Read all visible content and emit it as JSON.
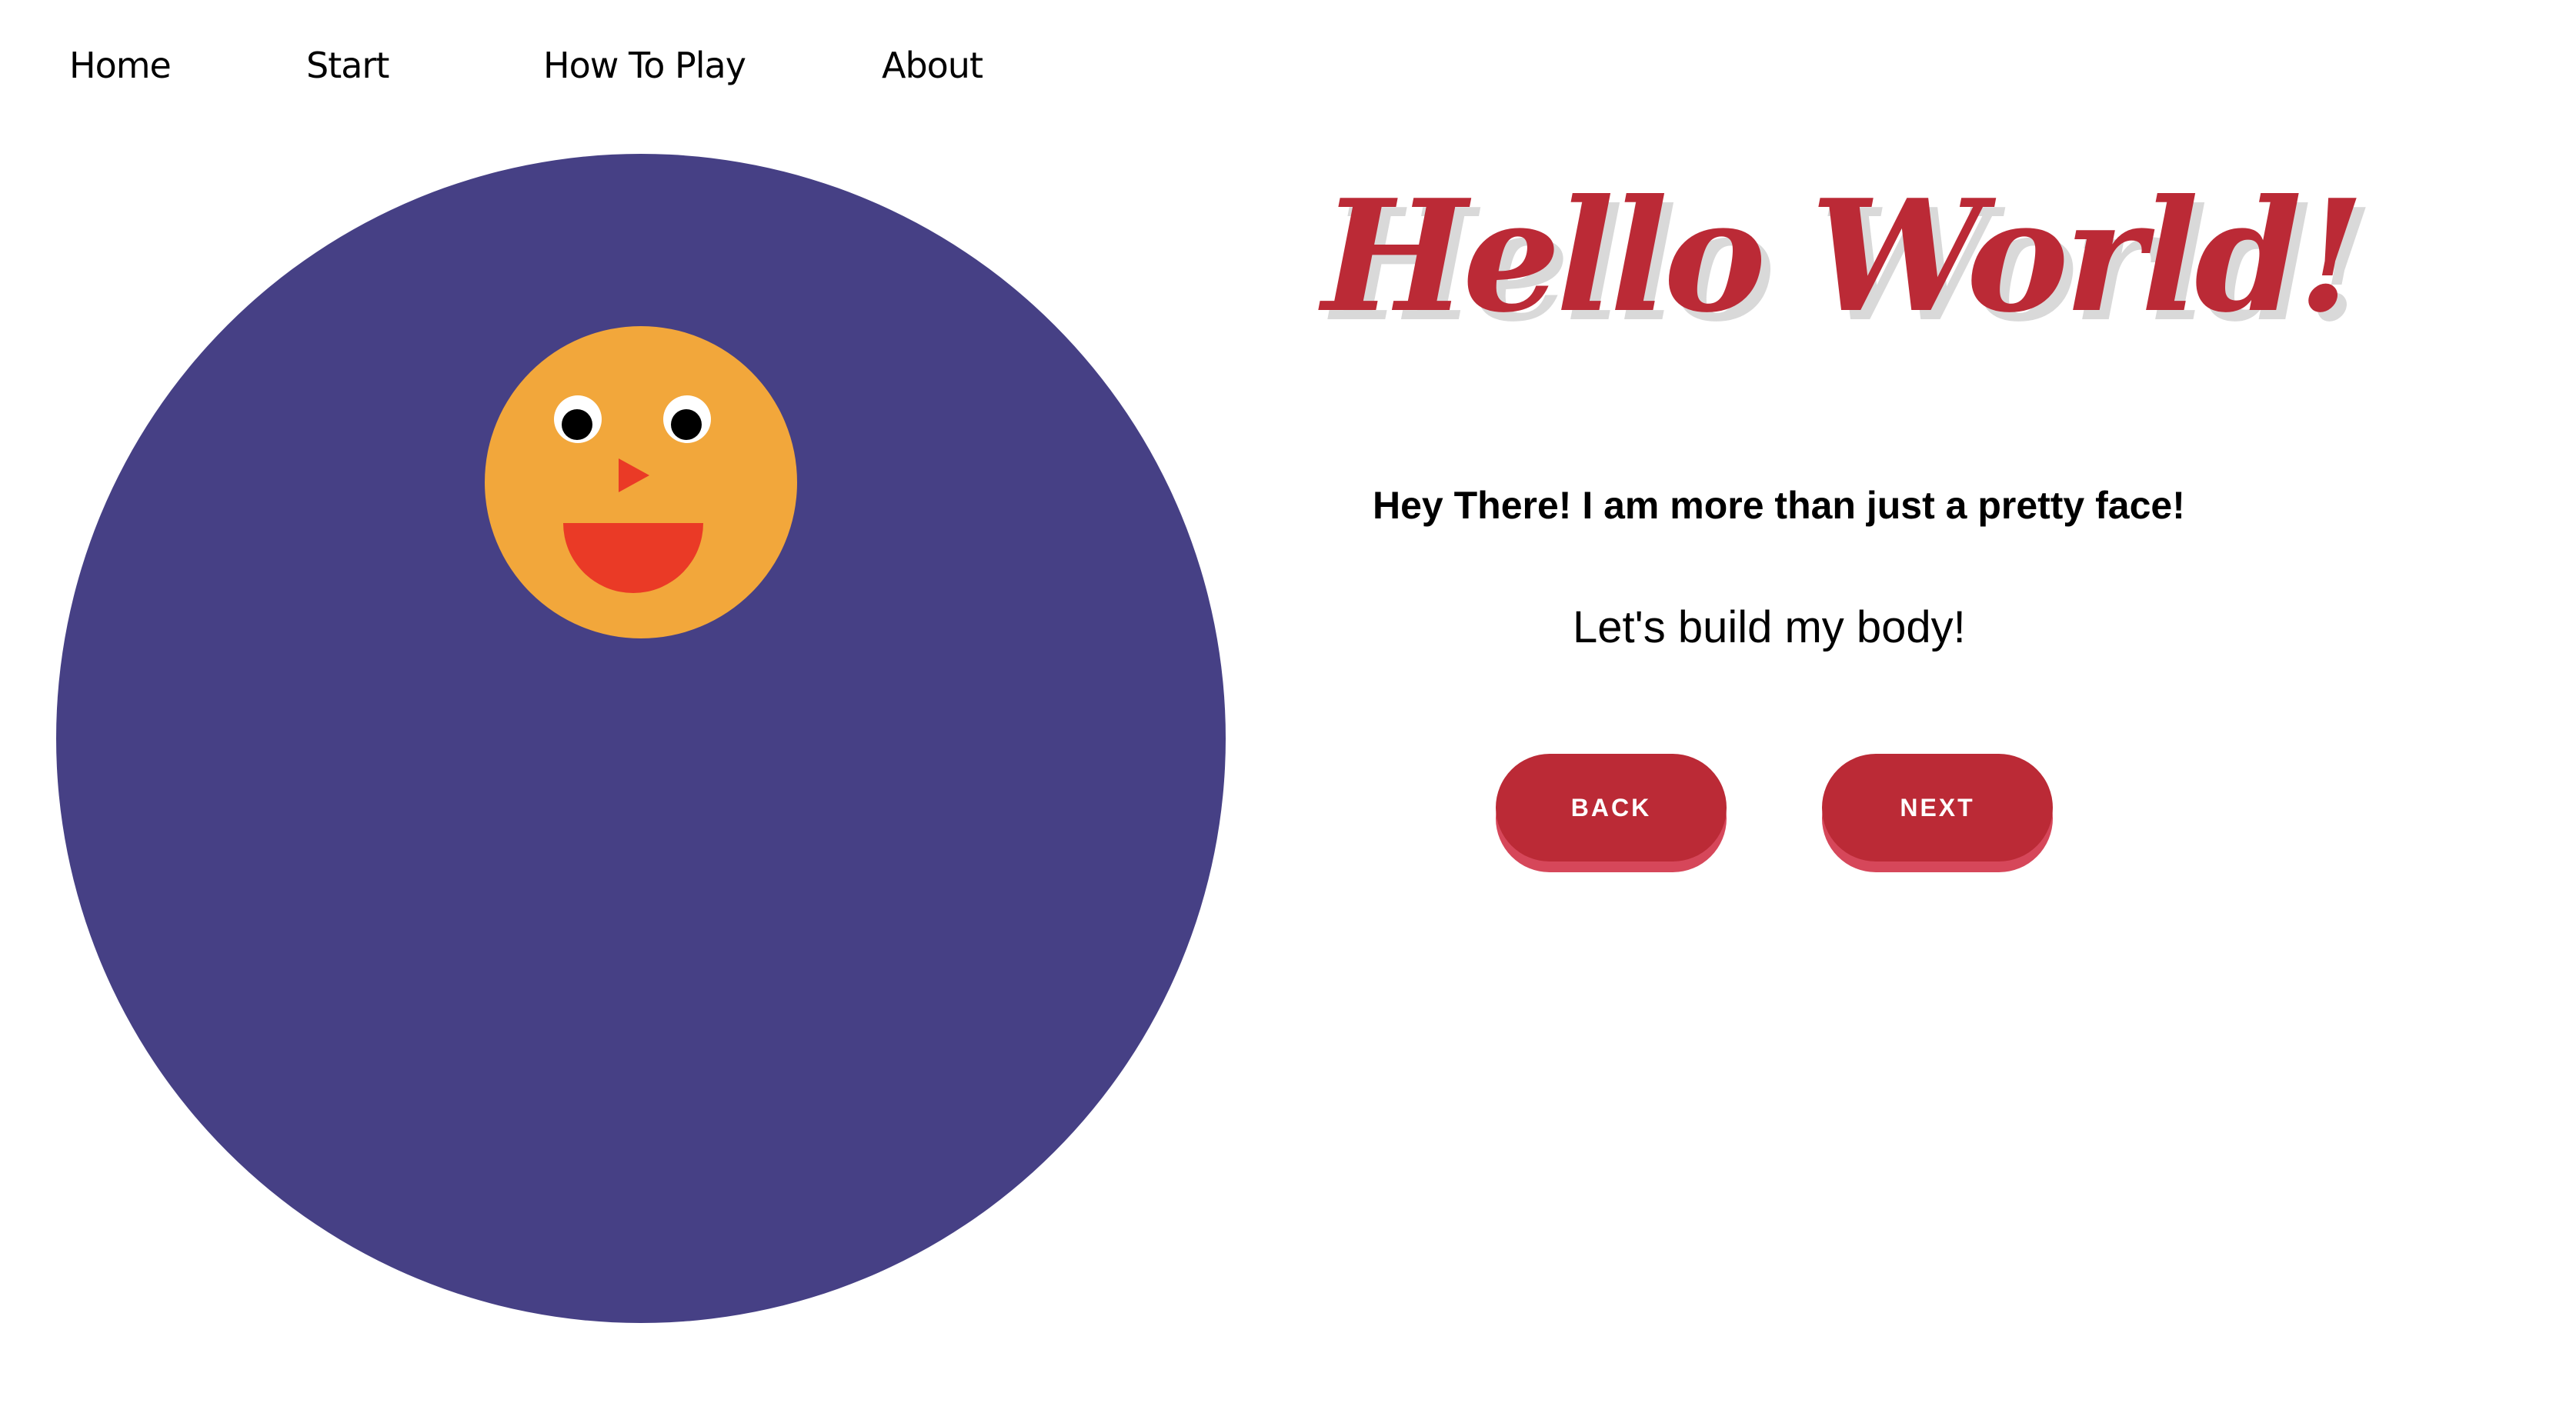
{
  "nav": {
    "items": [
      {
        "label": "Home"
      },
      {
        "label": "Start"
      },
      {
        "label": "How To Play"
      },
      {
        "label": "About"
      }
    ]
  },
  "hero": {
    "title": "Hello World!",
    "tagline": "Hey There! I am more than just a pretty face!",
    "subline": "Let's build my body!"
  },
  "buttons": {
    "back_label": "BACK",
    "next_label": "NEXT"
  },
  "colors": {
    "body_circle": "#464085",
    "face": "#f2a73b",
    "mouth_nose": "#ea3a26",
    "accent": "#bb2a36",
    "button_shadow": "#d6475a"
  }
}
